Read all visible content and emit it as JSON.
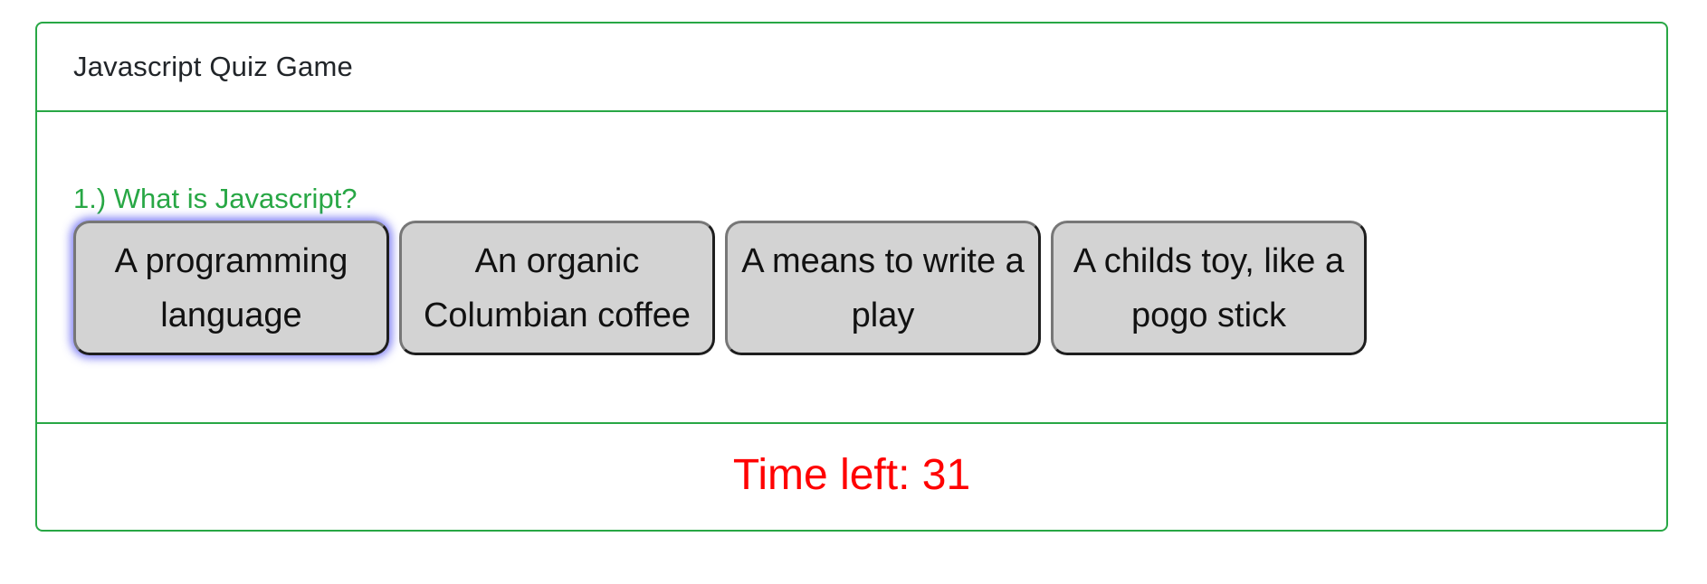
{
  "header": {
    "title": "Javascript Quiz Game"
  },
  "question": {
    "text": "1.) What is Javascript?"
  },
  "answers": [
    {
      "label": "A programming language"
    },
    {
      "label": "An organic Columbian coffee"
    },
    {
      "label": "A means to write a play"
    },
    {
      "label": "A childs toy, like a pogo stick"
    }
  ],
  "footer": {
    "timer_text": "Time left: 31"
  },
  "colors": {
    "border": "#28a745",
    "question": "#28a745",
    "timer": "#ff0000",
    "button_bg": "#d3d3d3"
  }
}
